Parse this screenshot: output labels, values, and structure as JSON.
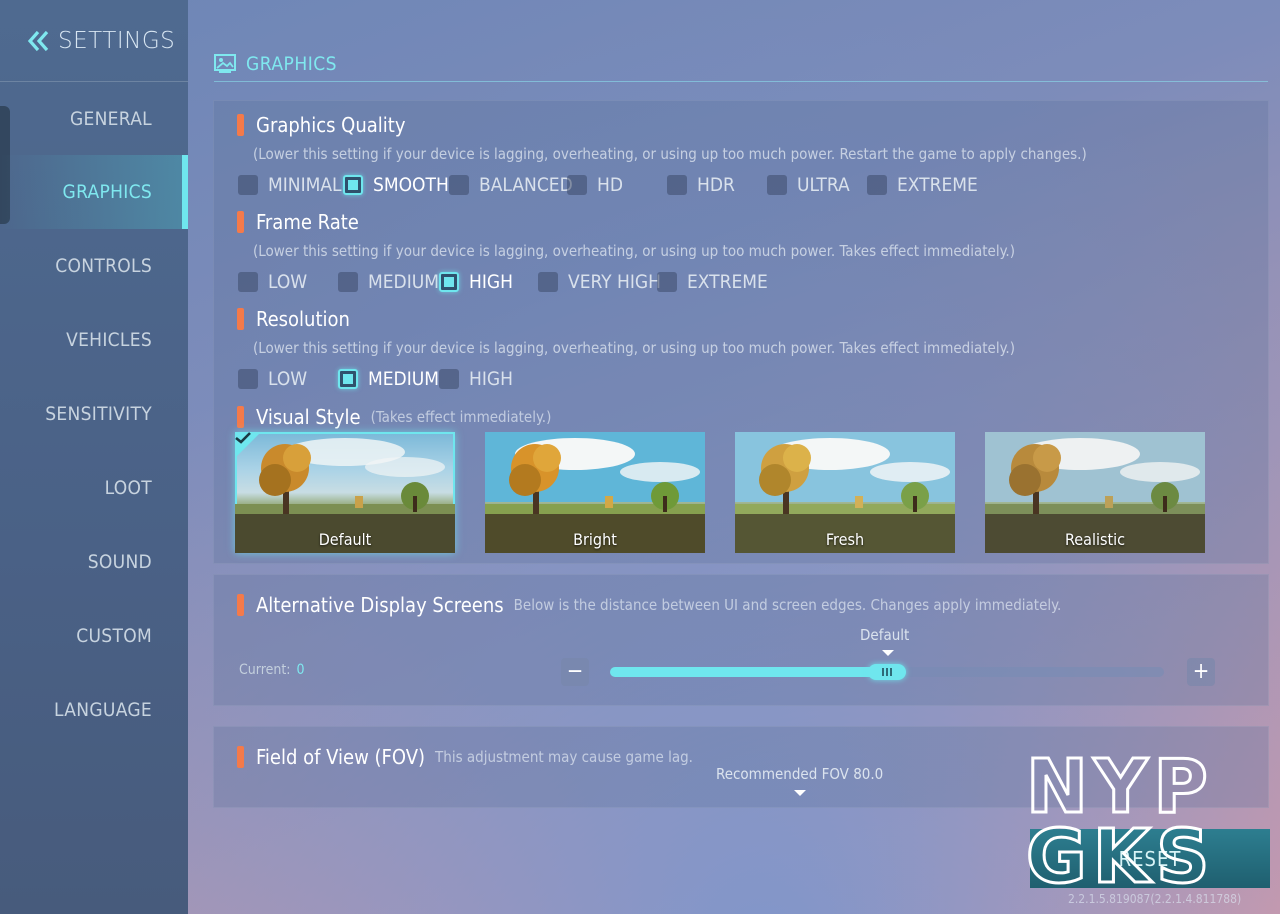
{
  "sidebar": {
    "title": "SETTINGS",
    "items": [
      {
        "label": "GENERAL"
      },
      {
        "label": "GRAPHICS"
      },
      {
        "label": "CONTROLS"
      },
      {
        "label": "VEHICLES"
      },
      {
        "label": "SENSITIVITY"
      },
      {
        "label": "LOOT"
      },
      {
        "label": "SOUND"
      },
      {
        "label": "CUSTOM"
      },
      {
        "label": "LANGUAGE"
      }
    ],
    "active": "GRAPHICS"
  },
  "section": {
    "title": "GRAPHICS"
  },
  "graphics_quality": {
    "label": "Graphics Quality",
    "hint": "(Lower this setting if your device is lagging, overheating, or using up too much power. Restart the game to apply changes.)",
    "options": [
      "MINIMAL",
      "SMOOTH",
      "BALANCED",
      "HD",
      "HDR",
      "ULTRA",
      "EXTREME"
    ],
    "selected": "SMOOTH"
  },
  "frame_rate": {
    "label": "Frame Rate",
    "hint": "(Lower this setting if your device is lagging, overheating, or using up too much power. Takes effect immediately.)",
    "options": [
      "LOW",
      "MEDIUM",
      "HIGH",
      "VERY HIGH",
      "EXTREME"
    ],
    "selected": "HIGH"
  },
  "resolution": {
    "label": "Resolution",
    "hint": "(Lower this setting if your device is lagging, overheating, or using up too much power. Takes effect immediately.)",
    "options": [
      "LOW",
      "MEDIUM",
      "HIGH"
    ],
    "selected": "MEDIUM"
  },
  "visual_style": {
    "label": "Visual Style",
    "hint": "(Takes effect immediately.)",
    "styles": [
      "Default",
      "Bright",
      "Fresh",
      "Realistic"
    ],
    "selected": "Default"
  },
  "display_screens": {
    "label": "Alternative Display Screens",
    "hint": "Below is the distance between UI and screen edges. Changes apply immediately.",
    "current_label": "Current:",
    "current_value": "0",
    "default_label": "Default",
    "slider_fraction": 0.5,
    "minus": "−",
    "plus": "+"
  },
  "fov": {
    "label": "Field of View (FOV)",
    "hint": "This adjustment may cause game lag.",
    "recommended": "Recommended FOV 80.0"
  },
  "reset": {
    "label": "RESET"
  },
  "version": "2.2.1.5.819087(2.2.1.4.811788)",
  "watermark": {
    "line1": "NYP",
    "line2": "GKS"
  },
  "colors": {
    "accent": "#6fe6ee",
    "marker": "#f47a4a"
  },
  "icons": {
    "back": "double-chevron-left-icon",
    "graphics": "image-icon",
    "check": "checkmark-icon"
  }
}
